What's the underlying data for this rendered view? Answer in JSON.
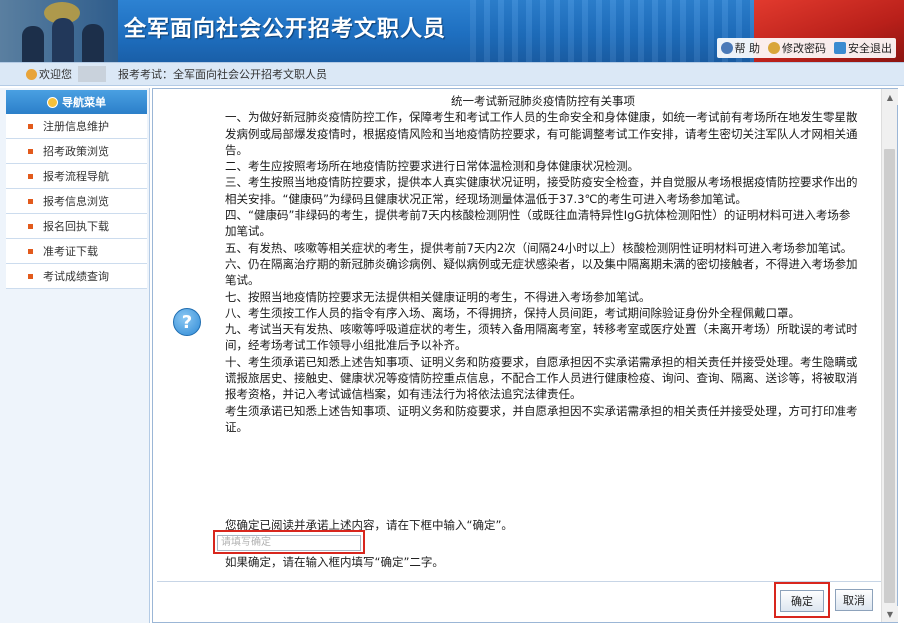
{
  "header": {
    "title": "全军面向社会公开招考文职人员",
    "links": {
      "help": "帮 助",
      "change_password": "修改密码",
      "logout": "安全退出"
    }
  },
  "subbar": {
    "welcome": "欢迎您",
    "breadcrumb": "报考考试：全军面向社会公开招考文职人员"
  },
  "sidebar": {
    "heading": "导航菜单",
    "items": [
      {
        "label": "注册信息维护"
      },
      {
        "label": "招考政策浏览"
      },
      {
        "label": "报考流程导航"
      },
      {
        "label": "报考信息浏览"
      },
      {
        "label": "报名回执下载"
      },
      {
        "label": "准考证下载"
      },
      {
        "label": "考试成绩查询"
      }
    ]
  },
  "notice": {
    "heading": "统一考试新冠肺炎疫情防控有关事项",
    "paragraphs": [
      "一、为做好新冠肺炎疫情防控工作，保障考生和考试工作人员的生命安全和身体健康，如统一考试前有考场所在地发生零星散发病例或局部爆发疫情时，根据疫情风险和当地疫情防控要求，有可能调整考试工作安排，请考生密切关注军队人才网相关通告。",
      "二、考生应按照考场所在地疫情防控要求进行日常体温检测和身体健康状况检测。",
      "三、考生按照当地疫情防控要求，提供本人真实健康状况证明，接受防疫安全检查，并自觉服从考场根据疫情防控要求作出的相关安排。“健康码”为绿码且健康状况正常，经现场测量体温低于37.3℃的考生可进入考场参加笔试。",
      "四、“健康码”非绿码的考生，提供考前7天内核酸检测阴性（或既往血清特异性IgG抗体检测阳性）的证明材料可进入考场参加笔试。",
      "五、有发热、咳嗽等相关症状的考生，提供考前7天内2次（间隔24小时以上）核酸检测阴性证明材料可进入考场参加笔试。",
      "六、仍在隔离治疗期的新冠肺炎确诊病例、疑似病例或无症状感染者，以及集中隔离期未满的密切接触者，不得进入考场参加笔试。",
      "七、按照当地疫情防控要求无法提供相关健康证明的考生，不得进入考场参加笔试。",
      "八、考生须按工作人员的指令有序入场、离场，不得拥挤，保持人员间距，考试期间除验证身份外全程佩戴口罩。",
      "九、考试当天有发热、咳嗽等呼吸道症状的考生，须转入备用隔离考室，转移考室或医疗处置（未离开考场）所耽误的考试时间，经考场考试工作领导小组批准后予以补齐。",
      "十、考生须承诺已知悉上述告知事项、证明义务和防疫要求，自愿承担因不实承诺需承担的相关责任并接受处理。考生隐瞒或谎报旅居史、接触史、健康状况等疫情防控重点信息，不配合工作人员进行健康检疫、询问、查询、隔离、送诊等，将被取消报考资格，并记入考试诚信档案，如有违法行为将依法追究法律责任。",
      "考生须承诺已知悉上述告知事项、证明义务和防疫要求，并自愿承担因不实承诺需承担的相关责任并接受处理，方可打印准考证。"
    ]
  },
  "confirm": {
    "instruction": "您确定已阅读并承诺上述内容，请在下框中输入“确定”。",
    "placeholder": "请填写确定",
    "value": "",
    "hint": "如果确定，请在输入框内填写“确定”二字。"
  },
  "buttons": {
    "ok": "确定",
    "cancel": "取消"
  }
}
